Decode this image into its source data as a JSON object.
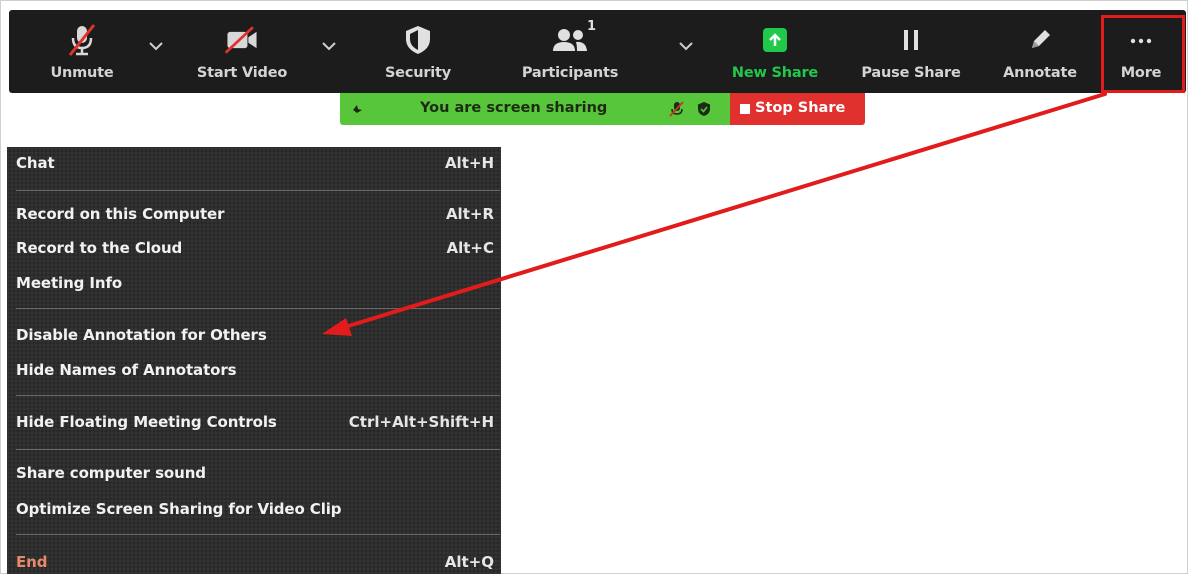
{
  "toolbar": {
    "unmute_label": "Unmute",
    "start_video_label": "Start Video",
    "security_label": "Security",
    "participants_label": "Participants",
    "participants_count": "1",
    "new_share_label": "New Share",
    "pause_share_label": "Pause Share",
    "annotate_label": "Annotate",
    "more_label": "More"
  },
  "share_banner": {
    "status_text": "You are screen sharing",
    "stop_label": "Stop Share"
  },
  "menu": {
    "items": [
      {
        "label": "Chat",
        "shortcut": "Alt+H"
      },
      {
        "label": "Record on this Computer",
        "shortcut": "Alt+R"
      },
      {
        "label": "Record to the Cloud",
        "shortcut": "Alt+C"
      },
      {
        "label": "Meeting Info",
        "shortcut": ""
      },
      {
        "label": "Disable Annotation for Others",
        "shortcut": ""
      },
      {
        "label": "Hide Names of Annotators",
        "shortcut": ""
      },
      {
        "label": "Hide Floating Meeting Controls",
        "shortcut": "Ctrl+Alt+Shift+H"
      },
      {
        "label": "Share computer sound",
        "shortcut": ""
      },
      {
        "label": "Optimize Screen Sharing for Video Clip",
        "shortcut": ""
      },
      {
        "label": "End",
        "shortcut": "Alt+Q"
      }
    ]
  },
  "colors": {
    "toolbar_bg": "#1c1c1c",
    "share_green": "#58c63a",
    "stop_red": "#e0312f",
    "annotation_red": "#e21b1b",
    "new_share_green": "#22c84a",
    "end_text": "#e8896a"
  },
  "icons": [
    "muted-mic-icon",
    "video-off-icon",
    "shield-icon",
    "participants-icon",
    "share-up-arrow-icon",
    "pause-icon",
    "pencil-icon",
    "ellipsis-icon"
  ]
}
